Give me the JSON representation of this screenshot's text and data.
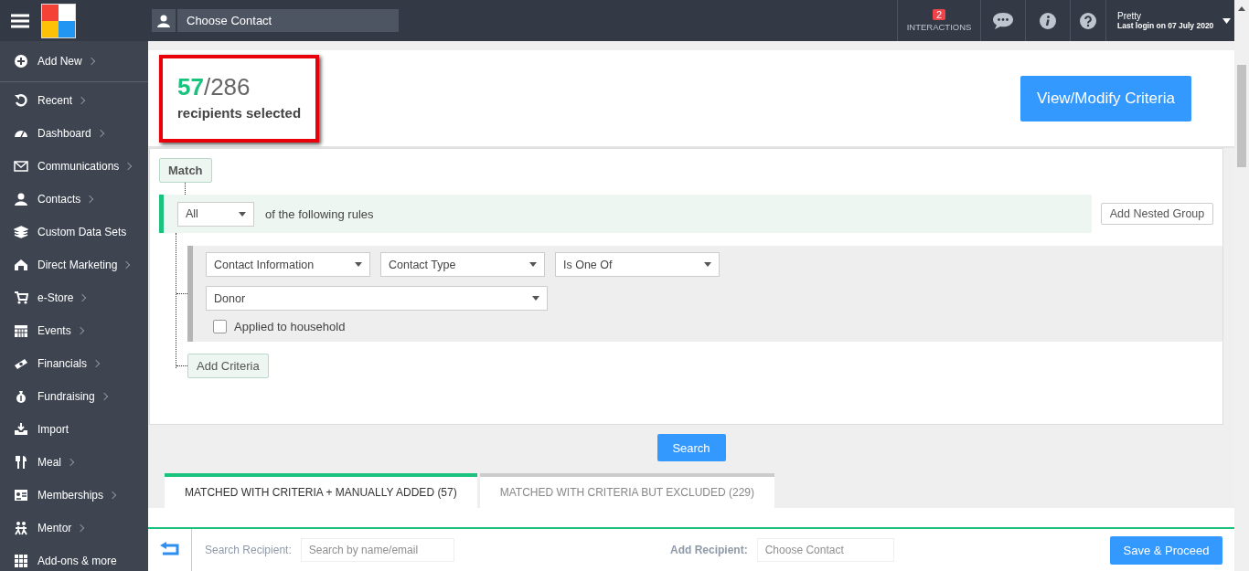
{
  "topbar": {
    "contact_search": {
      "placeholder": "Choose Contact"
    },
    "interactions": {
      "badge": "2",
      "label": "INTERACTIONS"
    },
    "user": {
      "name": "Pretty",
      "last_login": "Last login on 07 July 2020"
    }
  },
  "sidebar": {
    "items": [
      {
        "label": "Add New",
        "has_submenu": true
      },
      {
        "label": "Recent",
        "has_submenu": true
      },
      {
        "label": "Dashboard",
        "has_submenu": true
      },
      {
        "label": "Communications",
        "has_submenu": true
      },
      {
        "label": "Contacts",
        "has_submenu": true
      },
      {
        "label": "Custom Data Sets",
        "has_submenu": false
      },
      {
        "label": "Direct Marketing",
        "has_submenu": true
      },
      {
        "label": "e-Store",
        "has_submenu": true
      },
      {
        "label": "Events",
        "has_submenu": true
      },
      {
        "label": "Financials",
        "has_submenu": true
      },
      {
        "label": "Fundraising",
        "has_submenu": true
      },
      {
        "label": "Import",
        "has_submenu": false
      },
      {
        "label": "Meal",
        "has_submenu": true
      },
      {
        "label": "Memberships",
        "has_submenu": true
      },
      {
        "label": "Mentor",
        "has_submenu": true
      },
      {
        "label": "Add-ons & more",
        "has_submenu": false
      }
    ]
  },
  "summary": {
    "selected": "57",
    "total": "/286",
    "caption": "recipients selected",
    "highlighted": true
  },
  "criteria_button": "View/Modify Criteria",
  "rules": {
    "match_label": "Match",
    "quantifier": "All",
    "quantifier_suffix": "of the following rules",
    "add_group": "Add Nested Group",
    "conditions": [
      {
        "fields": [
          "Contact Information",
          "Contact Type",
          "Is One Of"
        ],
        "value": "Donor",
        "household": {
          "label": "Applied to household",
          "checked": false
        }
      }
    ],
    "add_criteria": "Add Criteria"
  },
  "search_button": "Search",
  "tabs": [
    {
      "label": "MATCHED WITH CRITERIA + MANUALLY ADDED (57)",
      "selected": true
    },
    {
      "label": "MATCHED WITH CRITERIA BUT EXCLUDED (229)",
      "selected": false
    }
  ],
  "recipient_bar": {
    "search_label": "Search Recipient:",
    "search_placeholder": "Search by name/email",
    "add_label": "Add Recipient:",
    "add_placeholder": "Choose Contact"
  },
  "footer": {
    "save_button": "Save & Proceed"
  }
}
